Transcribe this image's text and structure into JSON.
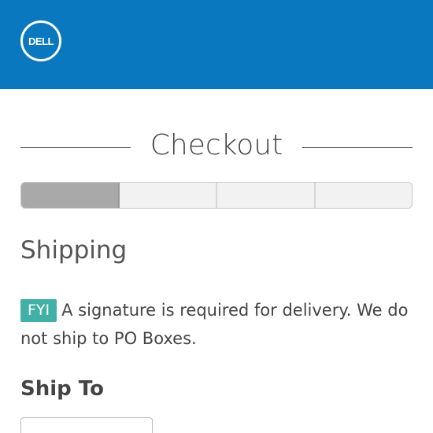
{
  "header": {
    "logo_text": "DELL",
    "brand_color": "#0a78bf"
  },
  "checkout": {
    "title": "Checkout",
    "progress": {
      "total_steps": 4,
      "current_step": 1
    }
  },
  "shipping": {
    "section_title": "Shipping",
    "notice_badge": "FYI",
    "notice_text": "A signature is required for delivery. We do not ship to PO Boxes.",
    "badge_color": "#41b0a7",
    "ship_to_label": "Ship To"
  }
}
